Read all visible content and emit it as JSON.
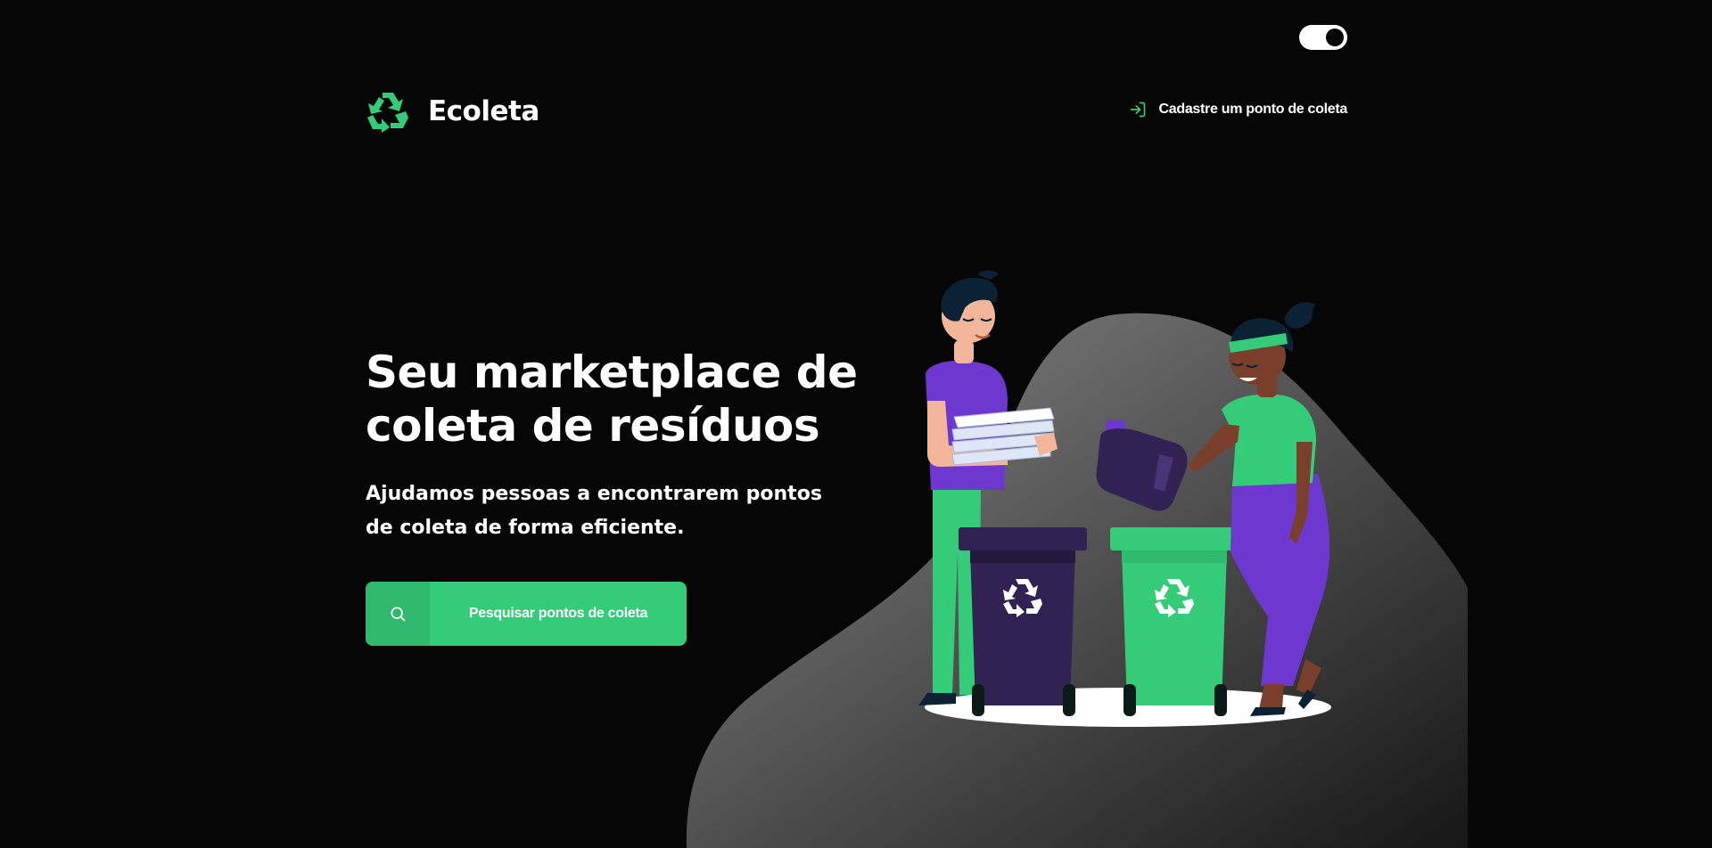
{
  "header": {
    "logo_text": "Ecoleta",
    "register_link_label": "Cadastre um ponto de coleta"
  },
  "hero": {
    "title": "Seu marketplace de coleta de resíduos",
    "subtitle": "Ajudamos pessoas a encontrarem pontos de coleta de forma eficiente.",
    "search_button_label": "Pesquisar pontos de coleta"
  },
  "theme_toggle": {
    "state": "dark"
  },
  "colors": {
    "background": "#060606",
    "accent": "#34cb79",
    "accent_dark": "#2fb86e",
    "text": "#ffffff",
    "purple": "#6c38d0",
    "dark_purple": "#322153"
  },
  "icons": {
    "logo": "recycle-icon",
    "register": "log-in-icon",
    "search": "search-icon",
    "bin": "recycle-icon"
  }
}
